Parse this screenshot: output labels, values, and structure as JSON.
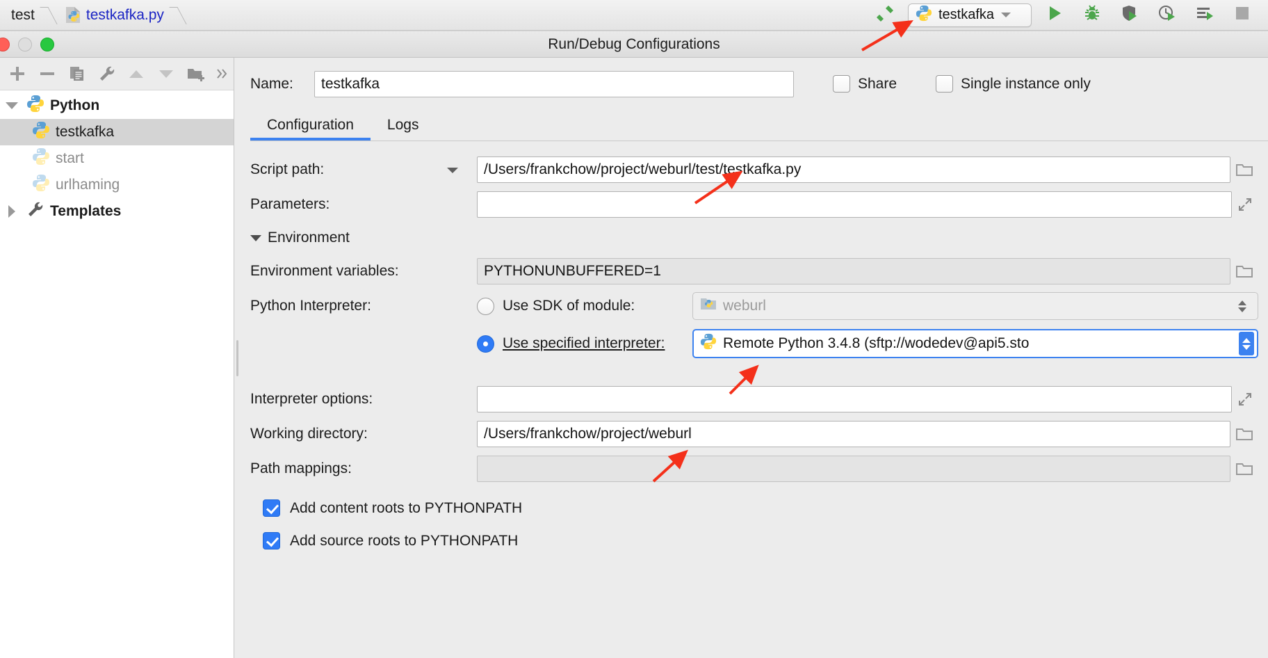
{
  "breadcrumb": {
    "items": [
      {
        "label": "test",
        "type": "folder"
      },
      {
        "label": "testkafka.py",
        "type": "python-file"
      }
    ]
  },
  "toolbar": {
    "build_icon": "hammer-icon",
    "run_config": {
      "label": "testkafka",
      "icon": "python-icon",
      "dropdown": "chevron-down-icon"
    },
    "actions": [
      {
        "name": "run-button",
        "icon": "play-icon"
      },
      {
        "name": "debug-button",
        "icon": "bug-icon"
      },
      {
        "name": "coverage-button",
        "icon": "coverage-icon"
      },
      {
        "name": "profile-button",
        "icon": "profile-clock-icon"
      },
      {
        "name": "run-with-console-button",
        "icon": "run-console-icon"
      },
      {
        "name": "stop-button",
        "icon": "stop-square-icon"
      }
    ]
  },
  "dialog": {
    "title": "Run/Debug Configurations",
    "window_controls": [
      "close",
      "minimize",
      "zoom"
    ]
  },
  "sidebar": {
    "tools": [
      {
        "name": "add-configuration-button",
        "icon": "plus-icon"
      },
      {
        "name": "remove-configuration-button",
        "icon": "minus-icon"
      },
      {
        "name": "copy-configuration-button",
        "icon": "copy-icon"
      },
      {
        "name": "edit-templates-button",
        "icon": "wrench-icon"
      },
      {
        "name": "move-up-button",
        "icon": "arrow-up-icon"
      },
      {
        "name": "move-down-button",
        "icon": "arrow-down-icon"
      },
      {
        "name": "create-folder-button",
        "icon": "folder-add-icon"
      },
      {
        "name": "more-actions-button",
        "icon": "chevron-double-right-icon"
      }
    ],
    "tree": [
      {
        "label": "Python",
        "level": 0,
        "expanded": true,
        "bold": true,
        "icon": "python-icon",
        "state": "normal"
      },
      {
        "label": "testkafka",
        "level": 1,
        "bold": false,
        "icon": "python-icon",
        "state": "selected"
      },
      {
        "label": "start",
        "level": 1,
        "bold": false,
        "icon": "python-icon-faded",
        "state": "dim"
      },
      {
        "label": "urlhaming",
        "level": 1,
        "bold": false,
        "icon": "python-icon-faded",
        "state": "dim"
      },
      {
        "label": "Templates",
        "level": 0,
        "expanded": false,
        "bold": true,
        "icon": "wrench-icon",
        "state": "normal"
      }
    ]
  },
  "form": {
    "name_label": "Name:",
    "name_value": "testkafka",
    "share": {
      "label": "Share",
      "checked": false
    },
    "single_instance": {
      "label": "Single instance only",
      "checked": false
    },
    "tabs": [
      {
        "label": "Configuration",
        "active": true
      },
      {
        "label": "Logs",
        "active": false
      }
    ],
    "script_path": {
      "label": "Script path:",
      "value": "/Users/frankchow/project/weburl/test/testkafka.py",
      "has_dropdown": true,
      "browse_icon": "folder-icon"
    },
    "parameters": {
      "label": "Parameters:",
      "value": "",
      "expand_icon": "expand-icon"
    },
    "environment_section": {
      "title": "Environment",
      "expanded": true,
      "env_vars": {
        "label": "Environment variables:",
        "value": "PYTHONUNBUFFERED=1",
        "browse_icon": "folder-icon"
      },
      "python_interpreter": {
        "label": "Python Interpreter:",
        "use_sdk_of_module": {
          "label": "Use SDK of module:",
          "selected": false,
          "value": "weburl",
          "icon": "module-icon"
        },
        "use_specified_interpreter": {
          "label": "Use specified interpreter:",
          "selected": true,
          "value": "Remote Python 3.4.8 (sftp://wodedev@api5.sto",
          "icon": "python-icon",
          "focused": true
        }
      },
      "interpreter_options": {
        "label": "Interpreter options:",
        "value": "",
        "expand_icon": "expand-icon"
      },
      "working_directory": {
        "label": "Working directory:",
        "value": "/Users/frankchow/project/weburl",
        "browse_icon": "folder-icon"
      },
      "path_mappings": {
        "label": "Path mappings:",
        "value": "",
        "browse_icon": "folder-icon"
      },
      "checkboxes": [
        {
          "label": "Add content roots to PYTHONPATH",
          "checked": true
        },
        {
          "label": "Add source roots to PYTHONPATH",
          "checked": true
        }
      ]
    }
  },
  "annotations": {
    "arrow_color": "#f4301a",
    "arrows": [
      {
        "name": "arrow-to-run-config"
      },
      {
        "name": "arrow-to-script-path"
      },
      {
        "name": "arrow-to-interpreter"
      },
      {
        "name": "arrow-to-working-directory"
      }
    ]
  },
  "colors": {
    "accent": "#3c82f0",
    "link": "#1b24c4",
    "run_green": "#4ca64c",
    "arrow_red": "#f4301a"
  }
}
